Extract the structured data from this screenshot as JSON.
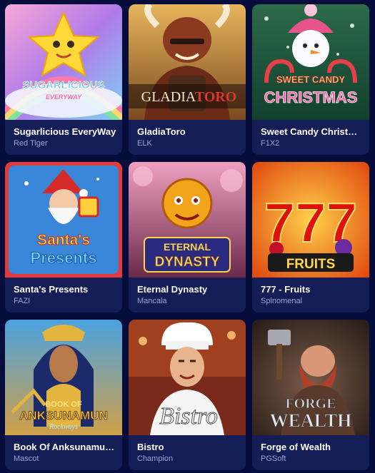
{
  "games": [
    {
      "title": "Sugarlicious EveryWay",
      "provider": "Red Tiger",
      "logo_line1": "SUGARLICIOUS",
      "logo_line2": "EVERYWAY"
    },
    {
      "title": "GladiaToro",
      "provider": "ELK",
      "logo_line1": "GLADIA",
      "logo_line2": "TORO"
    },
    {
      "title": "Sweet Candy Christmas",
      "provider": "F1X2",
      "logo_line1": "SWEET CANDY",
      "logo_line2": "CHRISTMAS"
    },
    {
      "title": "Santa's Presents",
      "provider": "FAZI",
      "logo_line1": "Santa's",
      "logo_line2": "Presents"
    },
    {
      "title": "Eternal Dynasty",
      "provider": "Mancala",
      "logo_line1": "ETERNAL",
      "logo_line2": "DYNASTY"
    },
    {
      "title": "777 - Fruits",
      "provider": "Spinomenal",
      "logo_line1": "777",
      "logo_line2": "FRUITS"
    },
    {
      "title": "Book Of Anksunamun Rockways",
      "provider": "Mascot",
      "logo_line1": "BOOK OF",
      "logo_line2": "ANKSUNAMUN",
      "logo_line3": "Rockways"
    },
    {
      "title": "Bistro",
      "provider": "Champion",
      "logo_line1": "Bistro"
    },
    {
      "title": "Forge of Wealth",
      "provider": "PGSoft",
      "logo_line1": "FORGE",
      "logo_line2": "WEALTH"
    }
  ]
}
